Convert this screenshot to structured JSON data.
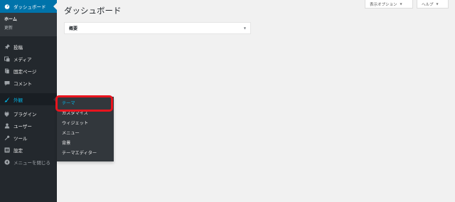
{
  "sidebar": {
    "dashboard": "ダッシュボード",
    "sub": [
      "ホーム",
      "更新"
    ],
    "items": [
      {
        "label": "投稿",
        "icon": "pin-icon"
      },
      {
        "label": "メディア",
        "icon": "media-icon"
      },
      {
        "label": "固定ページ",
        "icon": "page-icon"
      },
      {
        "label": "コメント",
        "icon": "comment-icon"
      }
    ],
    "appearance": "外観",
    "items2": [
      {
        "label": "プラグイン",
        "icon": "plugin-icon"
      },
      {
        "label": "ユーザー",
        "icon": "user-icon"
      },
      {
        "label": "ツール",
        "icon": "wrench-icon"
      },
      {
        "label": "設定",
        "icon": "settings-icon"
      }
    ],
    "collapse": "メニューを閉じる"
  },
  "flyout": [
    "テーマ",
    "カスタマイズ",
    "ウィジェット",
    "メニュー",
    "背景",
    "テーマエディター"
  ],
  "header": {
    "title": "ダッシュボード",
    "screen_options": "表示オプション",
    "help": "ヘルプ"
  },
  "panel": {
    "title": "概要"
  },
  "colors": {
    "sidebar_bg": "#23282d",
    "accent": "#0073aa",
    "hover_text": "#00b9eb",
    "highlight": "#e8141e"
  }
}
